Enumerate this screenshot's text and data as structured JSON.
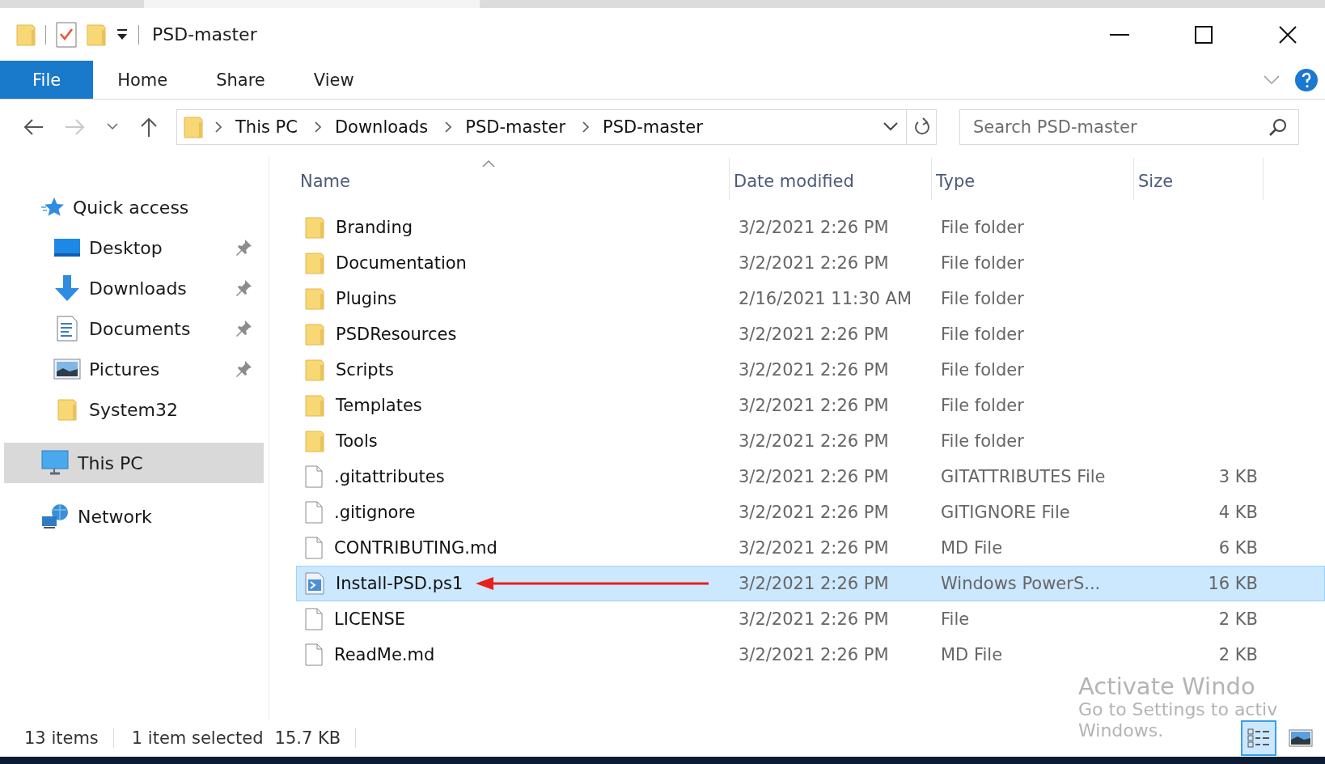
{
  "window": {
    "title": "PSD-master"
  },
  "ribbon": {
    "tabs": [
      {
        "label": "File",
        "selected": true
      },
      {
        "label": "Home",
        "selected": false
      },
      {
        "label": "Share",
        "selected": false
      },
      {
        "label": "View",
        "selected": false
      }
    ]
  },
  "address": {
    "path": [
      "This PC",
      "Downloads",
      "PSD-master",
      "PSD-master"
    ]
  },
  "search": {
    "placeholder": "Search PSD-master"
  },
  "sidebar": {
    "items": [
      {
        "label": "Quick access",
        "kind": "star",
        "selected": false,
        "children": [
          {
            "label": "Desktop",
            "kind": "desktop",
            "pinned": true
          },
          {
            "label": "Downloads",
            "kind": "download",
            "pinned": true
          },
          {
            "label": "Documents",
            "kind": "document",
            "pinned": true
          },
          {
            "label": "Pictures",
            "kind": "pictures",
            "pinned": true
          },
          {
            "label": "System32",
            "kind": "folder",
            "pinned": false
          }
        ]
      },
      {
        "label": "This PC",
        "kind": "computer",
        "selected": true
      },
      {
        "label": "Network",
        "kind": "network",
        "selected": false
      }
    ]
  },
  "columns": [
    {
      "label": "Name",
      "sorted": true
    },
    {
      "label": "Date modified",
      "sorted": false
    },
    {
      "label": "Type",
      "sorted": false
    },
    {
      "label": "Size",
      "sorted": false
    }
  ],
  "files": [
    {
      "name": "Branding",
      "kind": "folder",
      "date": "3/2/2021 2:26 PM",
      "type": "File folder",
      "selected": false,
      "arrow": false
    },
    {
      "name": "Documentation",
      "kind": "folder",
      "date": "3/2/2021 2:26 PM",
      "type": "File folder",
      "selected": false,
      "arrow": false
    },
    {
      "name": "Plugins",
      "kind": "folder",
      "date": "2/16/2021 11:30 AM",
      "type": "File folder",
      "selected": false,
      "arrow": false
    },
    {
      "name": "PSDResources",
      "kind": "folder",
      "date": "3/2/2021 2:26 PM",
      "type": "File folder",
      "selected": false,
      "arrow": false
    },
    {
      "name": "Scripts",
      "kind": "folder",
      "date": "3/2/2021 2:26 PM",
      "type": "File folder",
      "selected": false,
      "arrow": false
    },
    {
      "name": "Templates",
      "kind": "folder",
      "date": "3/2/2021 2:26 PM",
      "type": "File folder",
      "selected": false,
      "arrow": false
    },
    {
      "name": "Tools",
      "kind": "folder",
      "date": "3/2/2021 2:26 PM",
      "type": "File folder",
      "selected": false,
      "arrow": false
    },
    {
      "name": ".gitattributes",
      "kind": "file",
      "date": "3/2/2021 2:26 PM",
      "type": "GITATTRIBUTES File",
      "size": "3 KB",
      "selected": false,
      "arrow": false
    },
    {
      "name": ".gitignore",
      "kind": "file",
      "date": "3/2/2021 2:26 PM",
      "type": "GITIGNORE File",
      "size": "4 KB",
      "selected": false,
      "arrow": false
    },
    {
      "name": "CONTRIBUTING.md",
      "kind": "file",
      "date": "3/2/2021 2:26 PM",
      "type": "MD File",
      "size": "6 KB",
      "selected": false,
      "arrow": false
    },
    {
      "name": "Install-PSD.ps1",
      "kind": "script",
      "date": "3/2/2021 2:26 PM",
      "type": "Windows PowerS...",
      "size": "16 KB",
      "selected": true,
      "arrow": true
    },
    {
      "name": "LICENSE",
      "kind": "file",
      "date": "3/2/2021 2:26 PM",
      "type": "File",
      "size": "2 KB",
      "selected": false,
      "arrow": false
    },
    {
      "name": "ReadMe.md",
      "kind": "file",
      "date": "3/2/2021 2:26 PM",
      "type": "MD File",
      "size": "2 KB",
      "selected": false,
      "arrow": false
    }
  ],
  "status_bar": {
    "count": "13 items",
    "selection": "1 item selected",
    "size": "15.7 KB",
    "views": [
      {
        "kind": "details",
        "selected": true
      },
      {
        "kind": "large-icons",
        "selected": false
      }
    ]
  },
  "activation_notice": {
    "lines": [
      "Activate Windo",
      "Go to Settings to activ",
      "Windows."
    ]
  }
}
